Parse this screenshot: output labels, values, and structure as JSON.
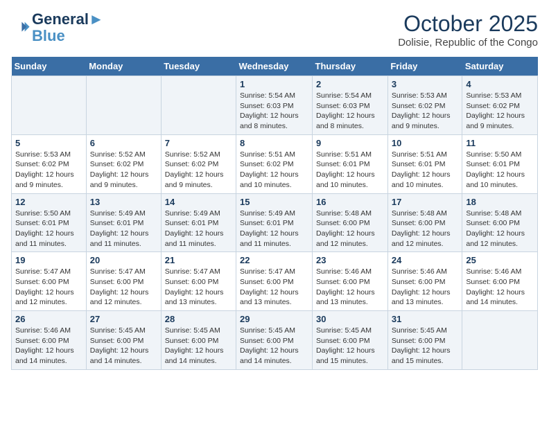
{
  "logo": {
    "line1": "General",
    "line2": "Blue"
  },
  "title": "October 2025",
  "location": "Dolisie, Republic of the Congo",
  "days_of_week": [
    "Sunday",
    "Monday",
    "Tuesday",
    "Wednesday",
    "Thursday",
    "Friday",
    "Saturday"
  ],
  "weeks": [
    [
      {
        "day": "",
        "text": ""
      },
      {
        "day": "",
        "text": ""
      },
      {
        "day": "",
        "text": ""
      },
      {
        "day": "1",
        "text": "Sunrise: 5:54 AM\nSunset: 6:03 PM\nDaylight: 12 hours and 8 minutes."
      },
      {
        "day": "2",
        "text": "Sunrise: 5:54 AM\nSunset: 6:03 PM\nDaylight: 12 hours and 8 minutes."
      },
      {
        "day": "3",
        "text": "Sunrise: 5:53 AM\nSunset: 6:02 PM\nDaylight: 12 hours and 9 minutes."
      },
      {
        "day": "4",
        "text": "Sunrise: 5:53 AM\nSunset: 6:02 PM\nDaylight: 12 hours and 9 minutes."
      }
    ],
    [
      {
        "day": "5",
        "text": "Sunrise: 5:53 AM\nSunset: 6:02 PM\nDaylight: 12 hours and 9 minutes."
      },
      {
        "day": "6",
        "text": "Sunrise: 5:52 AM\nSunset: 6:02 PM\nDaylight: 12 hours and 9 minutes."
      },
      {
        "day": "7",
        "text": "Sunrise: 5:52 AM\nSunset: 6:02 PM\nDaylight: 12 hours and 9 minutes."
      },
      {
        "day": "8",
        "text": "Sunrise: 5:51 AM\nSunset: 6:02 PM\nDaylight: 12 hours and 10 minutes."
      },
      {
        "day": "9",
        "text": "Sunrise: 5:51 AM\nSunset: 6:01 PM\nDaylight: 12 hours and 10 minutes."
      },
      {
        "day": "10",
        "text": "Sunrise: 5:51 AM\nSunset: 6:01 PM\nDaylight: 12 hours and 10 minutes."
      },
      {
        "day": "11",
        "text": "Sunrise: 5:50 AM\nSunset: 6:01 PM\nDaylight: 12 hours and 10 minutes."
      }
    ],
    [
      {
        "day": "12",
        "text": "Sunrise: 5:50 AM\nSunset: 6:01 PM\nDaylight: 12 hours and 11 minutes."
      },
      {
        "day": "13",
        "text": "Sunrise: 5:49 AM\nSunset: 6:01 PM\nDaylight: 12 hours and 11 minutes."
      },
      {
        "day": "14",
        "text": "Sunrise: 5:49 AM\nSunset: 6:01 PM\nDaylight: 12 hours and 11 minutes."
      },
      {
        "day": "15",
        "text": "Sunrise: 5:49 AM\nSunset: 6:01 PM\nDaylight: 12 hours and 11 minutes."
      },
      {
        "day": "16",
        "text": "Sunrise: 5:48 AM\nSunset: 6:00 PM\nDaylight: 12 hours and 12 minutes."
      },
      {
        "day": "17",
        "text": "Sunrise: 5:48 AM\nSunset: 6:00 PM\nDaylight: 12 hours and 12 minutes."
      },
      {
        "day": "18",
        "text": "Sunrise: 5:48 AM\nSunset: 6:00 PM\nDaylight: 12 hours and 12 minutes."
      }
    ],
    [
      {
        "day": "19",
        "text": "Sunrise: 5:47 AM\nSunset: 6:00 PM\nDaylight: 12 hours and 12 minutes."
      },
      {
        "day": "20",
        "text": "Sunrise: 5:47 AM\nSunset: 6:00 PM\nDaylight: 12 hours and 12 minutes."
      },
      {
        "day": "21",
        "text": "Sunrise: 5:47 AM\nSunset: 6:00 PM\nDaylight: 12 hours and 13 minutes."
      },
      {
        "day": "22",
        "text": "Sunrise: 5:47 AM\nSunset: 6:00 PM\nDaylight: 12 hours and 13 minutes."
      },
      {
        "day": "23",
        "text": "Sunrise: 5:46 AM\nSunset: 6:00 PM\nDaylight: 12 hours and 13 minutes."
      },
      {
        "day": "24",
        "text": "Sunrise: 5:46 AM\nSunset: 6:00 PM\nDaylight: 12 hours and 13 minutes."
      },
      {
        "day": "25",
        "text": "Sunrise: 5:46 AM\nSunset: 6:00 PM\nDaylight: 12 hours and 14 minutes."
      }
    ],
    [
      {
        "day": "26",
        "text": "Sunrise: 5:46 AM\nSunset: 6:00 PM\nDaylight: 12 hours and 14 minutes."
      },
      {
        "day": "27",
        "text": "Sunrise: 5:45 AM\nSunset: 6:00 PM\nDaylight: 12 hours and 14 minutes."
      },
      {
        "day": "28",
        "text": "Sunrise: 5:45 AM\nSunset: 6:00 PM\nDaylight: 12 hours and 14 minutes."
      },
      {
        "day": "29",
        "text": "Sunrise: 5:45 AM\nSunset: 6:00 PM\nDaylight: 12 hours and 14 minutes."
      },
      {
        "day": "30",
        "text": "Sunrise: 5:45 AM\nSunset: 6:00 PM\nDaylight: 12 hours and 15 minutes."
      },
      {
        "day": "31",
        "text": "Sunrise: 5:45 AM\nSunset: 6:00 PM\nDaylight: 12 hours and 15 minutes."
      },
      {
        "day": "",
        "text": ""
      }
    ]
  ]
}
